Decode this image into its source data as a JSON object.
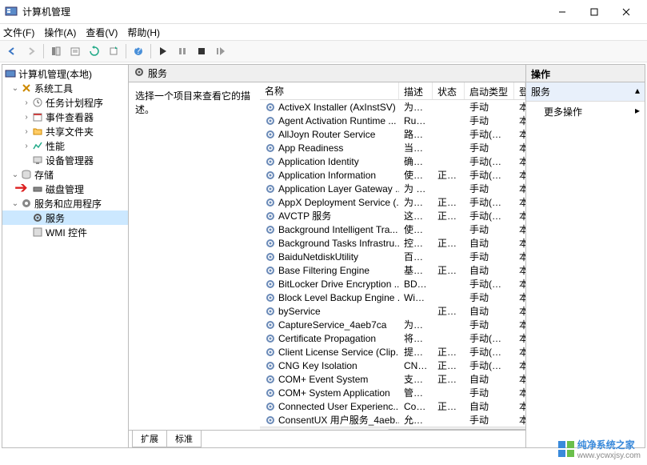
{
  "window": {
    "title": "计算机管理",
    "minimize": "–",
    "maximize": "□",
    "close": "×"
  },
  "menu": {
    "file": "文件(F)",
    "action": "操作(A)",
    "view": "查看(V)",
    "help": "帮助(H)"
  },
  "tree": {
    "root": "计算机管理(本地)",
    "system_tools": "系统工具",
    "task_scheduler": "任务计划程序",
    "event_viewer": "事件查看器",
    "shared_folders": "共享文件夹",
    "performance": "性能",
    "device_manager": "设备管理器",
    "storage": "存储",
    "disk_management": "磁盘管理",
    "services_apps": "服务和应用程序",
    "services": "服务",
    "wmi": "WMI 控件"
  },
  "center": {
    "header": "服务",
    "desc": "选择一个项目来查看它的描述。"
  },
  "columns": {
    "name": "名称",
    "desc": "描述",
    "status": "状态",
    "startup": "启动类型",
    "logon": "登"
  },
  "services": [
    {
      "name": "ActiveX Installer (AxInstSV)",
      "desc": "为从...",
      "status": "",
      "startup": "手动",
      "logon": "本"
    },
    {
      "name": "Agent Activation Runtime ...",
      "desc": "Run...",
      "status": "",
      "startup": "手动",
      "logon": "本"
    },
    {
      "name": "AllJoyn Router Service",
      "desc": "路由...",
      "status": "",
      "startup": "手动(触发...",
      "logon": "本"
    },
    {
      "name": "App Readiness",
      "desc": "当用...",
      "status": "",
      "startup": "手动",
      "logon": "本"
    },
    {
      "name": "Application Identity",
      "desc": "确定...",
      "status": "",
      "startup": "手动(触发...",
      "logon": "本"
    },
    {
      "name": "Application Information",
      "desc": "使用...",
      "status": "正在...",
      "startup": "手动(触发...",
      "logon": "本"
    },
    {
      "name": "Application Layer Gateway ...",
      "desc": "为 In...",
      "status": "",
      "startup": "手动",
      "logon": "本"
    },
    {
      "name": "AppX Deployment Service (...",
      "desc": "为部...",
      "status": "正在...",
      "startup": "手动(触发...",
      "logon": "本"
    },
    {
      "name": "AVCTP 服务",
      "desc": "这是...",
      "status": "正在...",
      "startup": "手动(触发...",
      "logon": "本"
    },
    {
      "name": "Background Intelligent Tra...",
      "desc": "使用...",
      "status": "",
      "startup": "手动",
      "logon": "本"
    },
    {
      "name": "Background Tasks Infrastru...",
      "desc": "控制...",
      "status": "正在...",
      "startup": "自动",
      "logon": "本"
    },
    {
      "name": "BaiduNetdiskUtility",
      "desc": "百度...",
      "status": "",
      "startup": "手动",
      "logon": "本"
    },
    {
      "name": "Base Filtering Engine",
      "desc": "基本...",
      "status": "正在...",
      "startup": "自动",
      "logon": "本"
    },
    {
      "name": "BitLocker Drive Encryption ...",
      "desc": "BDE...",
      "status": "",
      "startup": "手动(触发...",
      "logon": "本"
    },
    {
      "name": "Block Level Backup Engine ...",
      "desc": "Win...",
      "status": "",
      "startup": "手动",
      "logon": "本"
    },
    {
      "name": "byService",
      "desc": "",
      "status": "正在...",
      "startup": "自动",
      "logon": "本"
    },
    {
      "name": "CaptureService_4aeb7ca",
      "desc": "为调...",
      "status": "",
      "startup": "手动",
      "logon": "本"
    },
    {
      "name": "Certificate Propagation",
      "desc": "将用...",
      "status": "",
      "startup": "手动(触发...",
      "logon": "本"
    },
    {
      "name": "Client License Service (Clip...",
      "desc": "提供...",
      "status": "正在...",
      "startup": "手动(触发...",
      "logon": "本"
    },
    {
      "name": "CNG Key Isolation",
      "desc": "CNG...",
      "status": "正在...",
      "startup": "手动(触发...",
      "logon": "本"
    },
    {
      "name": "COM+ Event System",
      "desc": "支持...",
      "status": "正在...",
      "startup": "自动",
      "logon": "本"
    },
    {
      "name": "COM+ System Application",
      "desc": "管理...",
      "status": "",
      "startup": "手动",
      "logon": "本"
    },
    {
      "name": "Connected User Experienc...",
      "desc": "Con...",
      "status": "正在...",
      "startup": "自动",
      "logon": "本"
    },
    {
      "name": "ConsentUX 用户服务_4aeb...",
      "desc": "允许...",
      "status": "",
      "startup": "手动",
      "logon": "本"
    }
  ],
  "tabs": {
    "extended": "扩展",
    "standard": "标准"
  },
  "actions": {
    "header": "操作",
    "section": "服务",
    "more": "更多操作"
  },
  "watermark": {
    "name": "纯净系统之家",
    "url": "www.ycwxjsy.com"
  }
}
